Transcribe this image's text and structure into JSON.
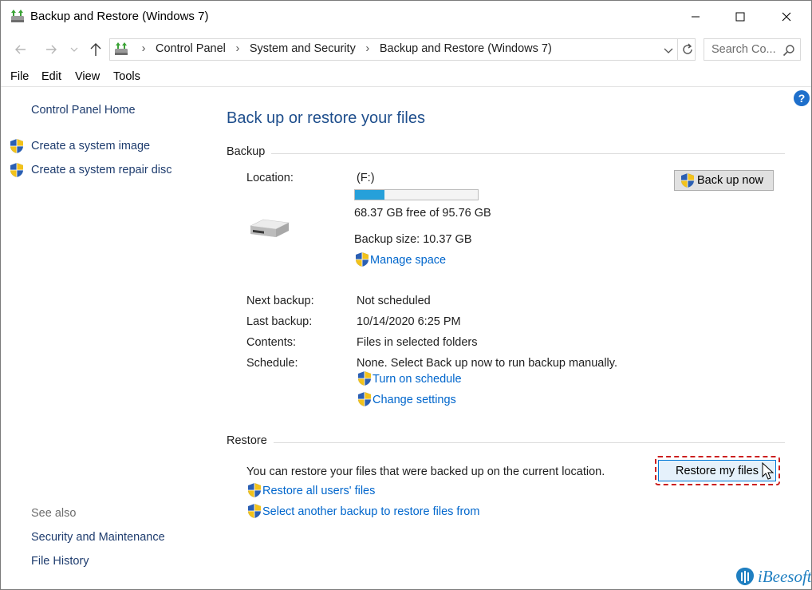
{
  "window": {
    "title": "Backup and Restore (Windows 7)",
    "app_icon": "backup-restore-icon"
  },
  "controls": {
    "minimize_icon": "minimize-icon",
    "maximize_icon": "maximize-icon",
    "close_icon": "close-icon"
  },
  "address_bar": {
    "breadcrumbs": [
      "Control Panel",
      "System and Security",
      "Backup and Restore (Windows 7)"
    ],
    "search_placeholder": "Search Co..."
  },
  "menu": [
    "File",
    "Edit",
    "View",
    "Tools"
  ],
  "sidebar": {
    "home": "Control Panel Home",
    "tasks": [
      "Create a system image",
      "Create a system repair disc"
    ],
    "see_also_label": "See also",
    "see_also": [
      "Security and Maintenance",
      "File History"
    ]
  },
  "main": {
    "heading": "Back up or restore your files",
    "backup": {
      "section_title": "Backup",
      "location_label": "Location:",
      "location_value": "(F:)",
      "usage_fraction": 0.24,
      "free_text": "68.37 GB free of 95.76 GB",
      "backup_size": "Backup size: 10.37 GB",
      "manage_space": "Manage space",
      "back_up_now": "Back up now",
      "next_backup_label": "Next backup:",
      "next_backup_value": "Not scheduled",
      "last_backup_label": "Last backup:",
      "last_backup_value": "10/14/2020 6:25 PM",
      "contents_label": "Contents:",
      "contents_value": "Files in selected folders",
      "schedule_label": "Schedule:",
      "schedule_value": "None. Select Back up now to run backup manually.",
      "turn_on_schedule": "Turn on schedule",
      "change_settings": "Change settings"
    },
    "restore": {
      "section_title": "Restore",
      "description": "You can restore your files that were backed up on the current location.",
      "restore_my_files": "Restore my files",
      "restore_all_users": "Restore all users' files",
      "select_another": "Select another backup to restore files from"
    }
  },
  "watermark": "iBeesoft",
  "colors": {
    "link": "#0066cc",
    "heading": "#1e4e8c",
    "progress": "#26a0da",
    "highlight": "#cc1f1f"
  }
}
